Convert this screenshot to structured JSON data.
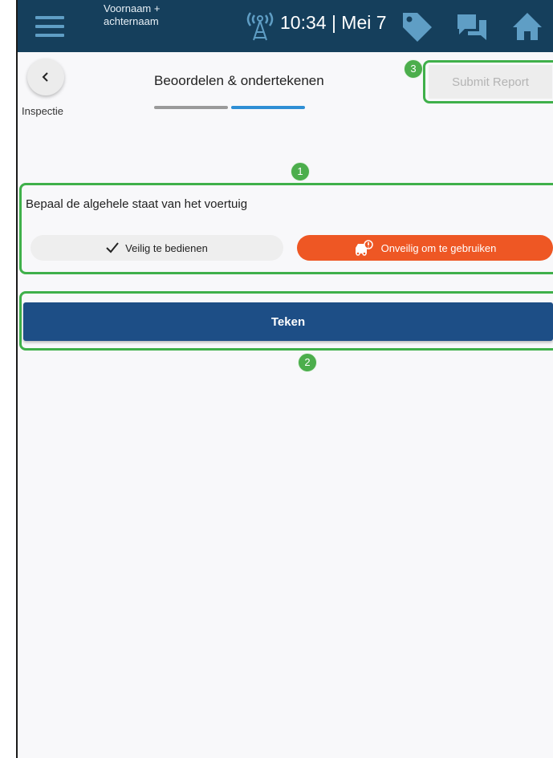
{
  "topbar": {
    "user_name": "Voornaam + achternaam",
    "datetime": "10:34 | Mei 7",
    "icons": [
      "menu-icon",
      "signal-icon",
      "tag-icon",
      "chat-icon",
      "home-icon"
    ]
  },
  "header": {
    "back_label": "Inspectie",
    "title": "Beoordelen & ondertekenen",
    "submit_label": "Submit Report",
    "steps": 2,
    "current_step": 2
  },
  "condition": {
    "question": "Bepaal de algehele staat van het voertuig",
    "safe_label": "Veilig te bedienen",
    "unsafe_label": "Onveilig om te gebruiken"
  },
  "sign": {
    "label": "Teken"
  },
  "markers": {
    "m1": "1",
    "m2": "2",
    "m3": "3"
  },
  "colors": {
    "topbar": "#153f5c",
    "highlight": "#3fb04a",
    "unsafe": "#ee5724",
    "sign_button": "#1d4e86",
    "step_active": "#2f8fd5"
  }
}
